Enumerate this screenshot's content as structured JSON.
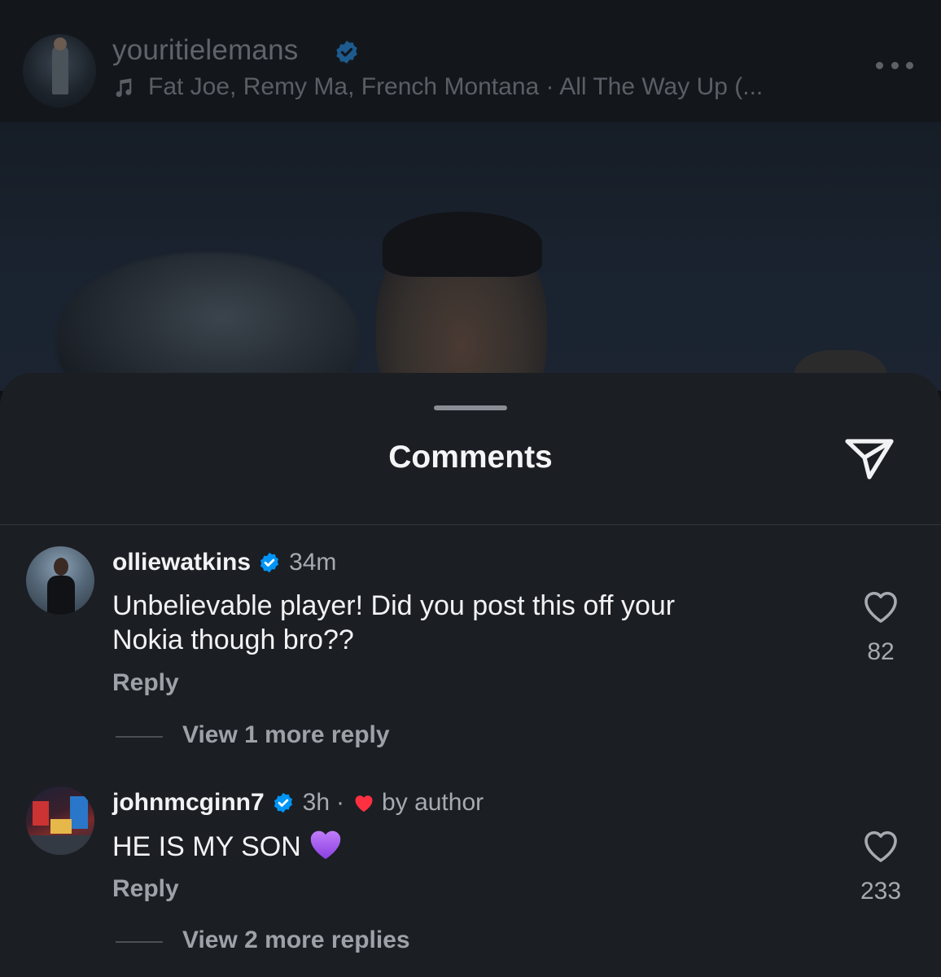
{
  "post": {
    "username": "youritielemans",
    "music": "Fat Joe, Remy Ma, French Montana · All The Way Up (..."
  },
  "sheet": {
    "title": "Comments"
  },
  "comments": [
    {
      "username": "olliewatkins",
      "verified": true,
      "time": "34m",
      "text_line1": "Unbelievable player! Did you post this off your",
      "text_line2": "Nokia though bro??",
      "reply_label": "Reply",
      "likes": "82",
      "view_replies": "View 1 more reply"
    },
    {
      "username": "johnmcginn7",
      "verified": true,
      "time": "3h",
      "separator": "·",
      "liked_by_author": "by author",
      "text": "HE IS MY SON",
      "reply_label": "Reply",
      "likes": "233",
      "view_replies": "View 2 more replies"
    }
  ],
  "colors": {
    "verified": "#0095f6",
    "author_heart": "#ff3040",
    "purple_heart": "#a45cf0",
    "sheet_bg": "#1b1e23"
  }
}
